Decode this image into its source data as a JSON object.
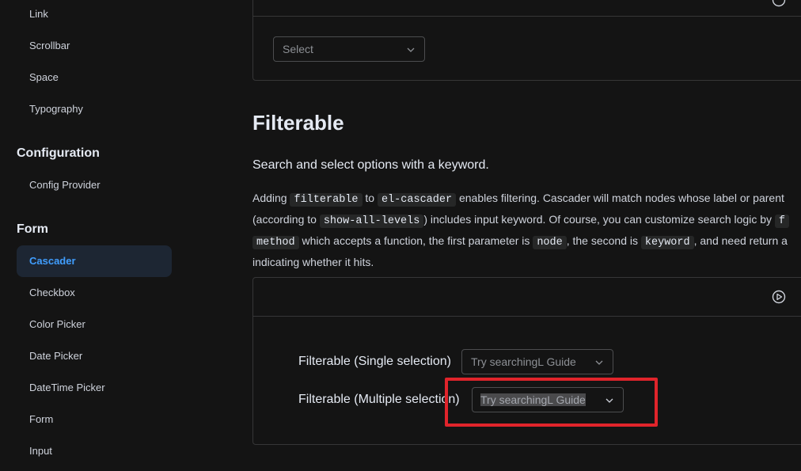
{
  "sidebar": {
    "items_top": [
      "Link",
      "Scrollbar",
      "Space",
      "Typography"
    ],
    "section_configuration": "Configuration",
    "config_items": [
      "Config Provider"
    ],
    "section_form": "Form",
    "form_items": [
      "Cascader",
      "Checkbox",
      "Color Picker",
      "Date Picker",
      "DateTime Picker",
      "Form",
      "Input"
    ],
    "active": "Cascader"
  },
  "top_demo": {
    "select_placeholder": "Select"
  },
  "section": {
    "title": "Filterable",
    "lead": "Search and select options with a keyword.",
    "p1_a": "Adding ",
    "code_filterable": "filterable",
    "p1_b": " to ",
    "code_cascader": "el-cascader",
    "p1_c": " enables filtering. Cascader will match nodes whose label or parent",
    "p2_a": "(according to ",
    "code_show_all": "show-all-levels",
    "p2_b": ") includes input keyword. Of course, you can customize search logic by ",
    "code_f": "f",
    "code_method": "method",
    "p3_a": " which accepts a function, the first parameter is ",
    "code_node": "node",
    "p3_b": ", the second is ",
    "code_keyword": "keyword",
    "p3_c": ", and need return a",
    "p4": "indicating whether it hits."
  },
  "demo": {
    "single_label": "Filterable (Single selection)",
    "single_placeholder": "Try searchingL Guide",
    "multiple_label": "Filterable (Multiple selection)",
    "multiple_value": "Try searchingL Guide"
  },
  "colors": {
    "accent": "#409eff",
    "highlight": "#e0242b",
    "background": "#141414"
  }
}
